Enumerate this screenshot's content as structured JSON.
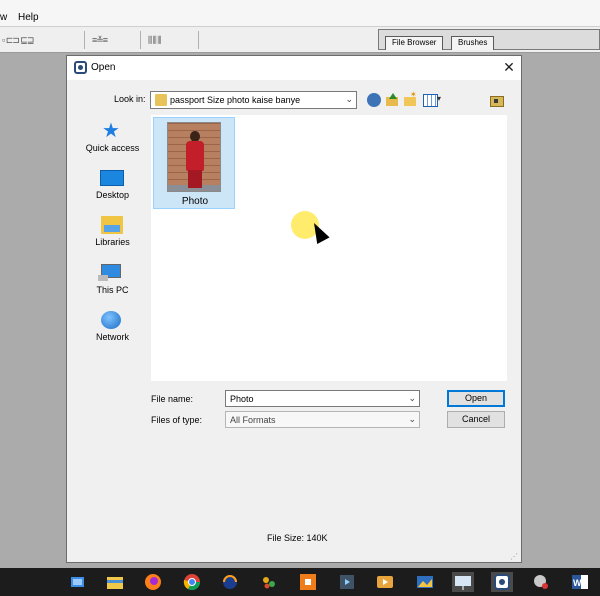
{
  "app": {
    "menu": [
      "w",
      "Help"
    ],
    "palette_tabs": [
      "File Browser",
      "Brushes"
    ]
  },
  "dialog": {
    "title": "Open",
    "close_glyph": "✕",
    "look_in_label": "Look in:",
    "look_in_value": "passport Size photo kaise banye",
    "places": [
      "Quick access",
      "Desktop",
      "Libraries",
      "This PC",
      "Network"
    ],
    "files": [
      {
        "name": "Photo",
        "selected": true
      }
    ],
    "file_name_label": "File name:",
    "file_name_value": "Photo",
    "files_of_type_label": "Files of type:",
    "files_of_type_value": "All Formats",
    "open_button": "Open",
    "cancel_button": "Cancel",
    "file_size": "File Size: 140K"
  },
  "taskbar": {
    "icons": [
      "task-view-icon",
      "file-explorer-icon",
      "firefox-icon",
      "chrome-icon",
      "media-app-icon",
      "paint-app-icon",
      "orange-app-icon",
      "generic-app-icon",
      "video-player-icon",
      "photo-app-icon",
      "presentation-icon",
      "open-dialog-app-icon",
      "recorder-icon",
      "word-icon"
    ]
  },
  "colors": {
    "selection": "#cde6f7",
    "accent": "#0078d7",
    "taskbar": "#1c1c1c"
  }
}
